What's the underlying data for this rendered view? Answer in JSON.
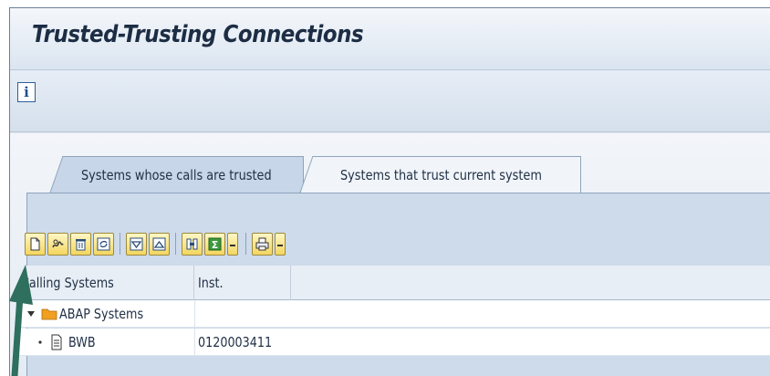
{
  "window": {
    "title": "Trusted-Trusting Connections"
  },
  "app_toolbar": {
    "info_icon_glyph": "i"
  },
  "tabs": [
    {
      "label": "Systems whose calls are trusted",
      "active": true
    },
    {
      "label": "Systems that trust current system",
      "active": false
    }
  ],
  "grid_toolbar": {
    "buttons": [
      "create-icon",
      "display-change-icon",
      "delete-icon",
      "refresh-icon",
      "sort-ascending-icon",
      "sort-descending-icon",
      "find-icon",
      "sum-icon",
      "sum-dropdown-icon",
      "print-icon",
      "print-dropdown-icon"
    ]
  },
  "grid": {
    "columns": [
      "Calling Systems",
      "Inst."
    ],
    "rows": [
      {
        "label": "ABAP Systems",
        "inst": "",
        "type": "folder",
        "expanded": true
      },
      {
        "label": "BWB",
        "inst": "0120003411",
        "type": "document"
      }
    ]
  },
  "colors": {
    "title_bg": "#dbe5f0",
    "tab_active": "#c7d6e8",
    "toolbar_button": "#f3d65f",
    "folder": "#f0a020",
    "arrow": "#2e6f5e"
  }
}
